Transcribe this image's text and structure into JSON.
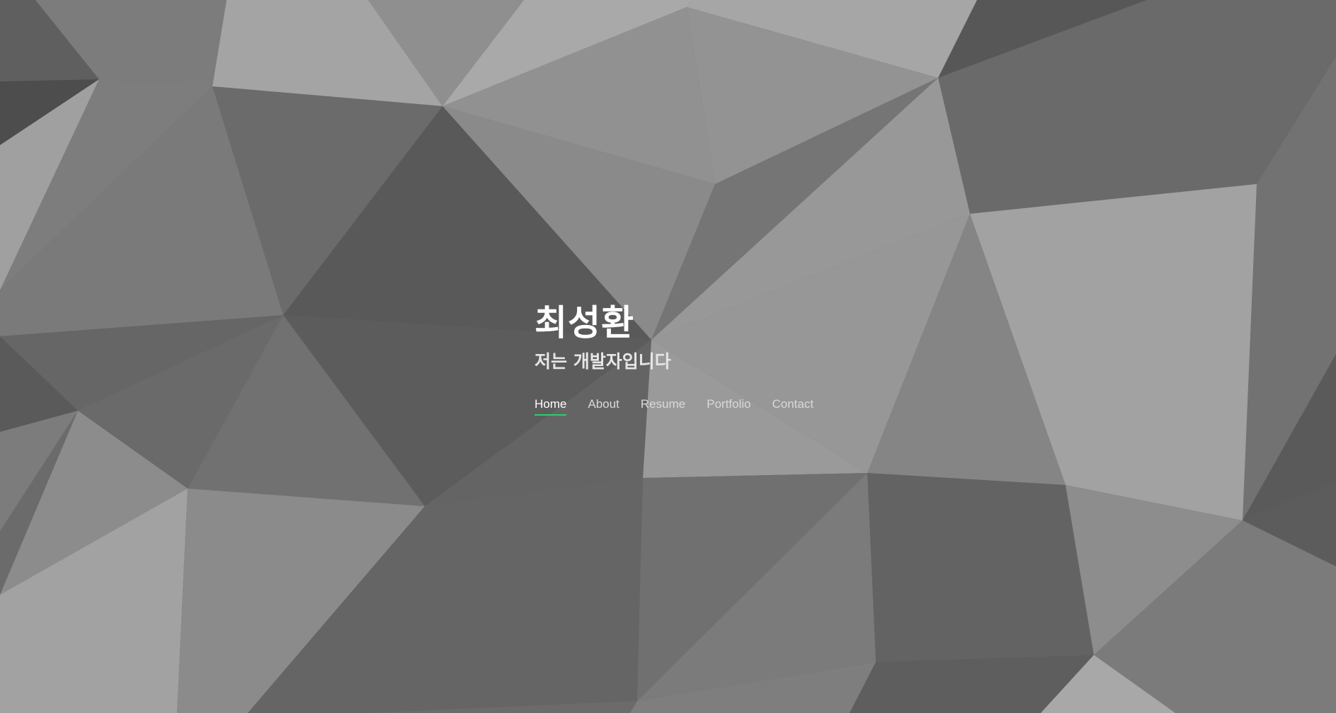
{
  "hero": {
    "name": "최성환",
    "tagline": "저는 개발자입니다"
  },
  "nav": {
    "items": [
      {
        "label": "Home",
        "active": true
      },
      {
        "label": "About",
        "active": false
      },
      {
        "label": "Resume",
        "active": false
      },
      {
        "label": "Portfolio",
        "active": false
      },
      {
        "label": "Contact",
        "active": false
      }
    ]
  },
  "colors": {
    "accent": "#2ecc71",
    "text_primary": "#ffffff"
  }
}
